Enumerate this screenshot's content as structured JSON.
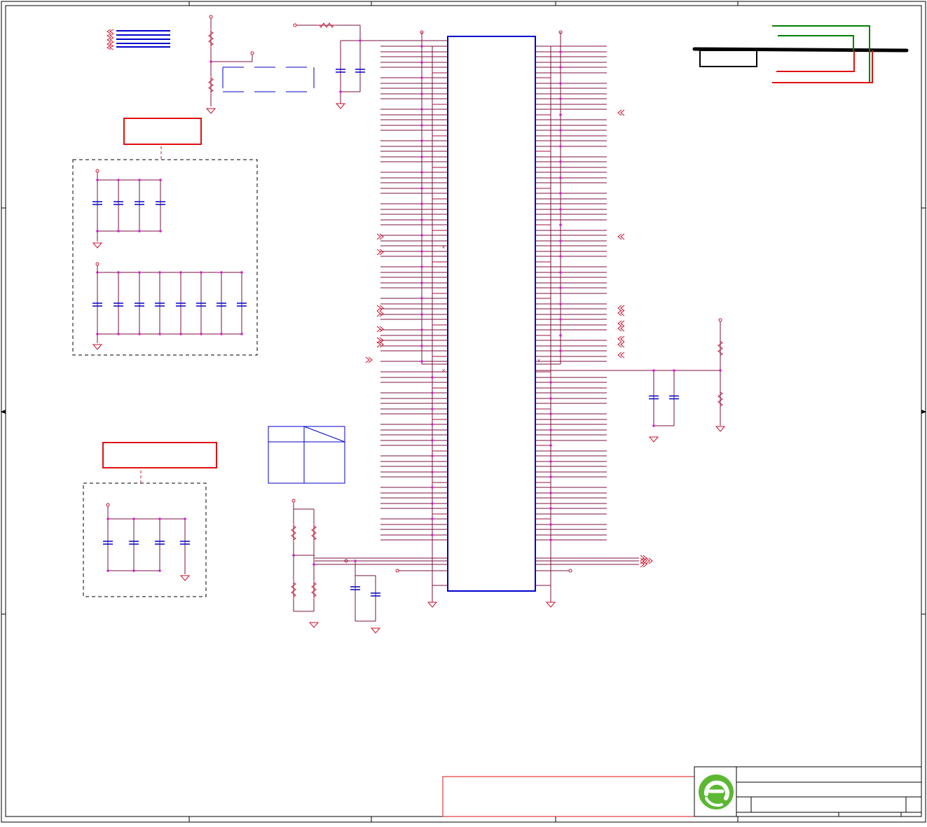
{
  "colors": {
    "frame": "#000000",
    "wire": "#7a1040",
    "pin": "#a0103a",
    "part": "#c8102e",
    "chip": "#0000cc",
    "junction": "#d020d0",
    "note_red": "#e01010",
    "note_green": "#008000",
    "logo_green": "#5cb833"
  },
  "icons": {
    "logo": "company-logo-icon",
    "ground": "ground-symbol-icon",
    "power": "power-rail-icon",
    "resistor": "resistor-icon",
    "capacitor": "capacitor-icon",
    "port": "off-page-connector-icon"
  }
}
